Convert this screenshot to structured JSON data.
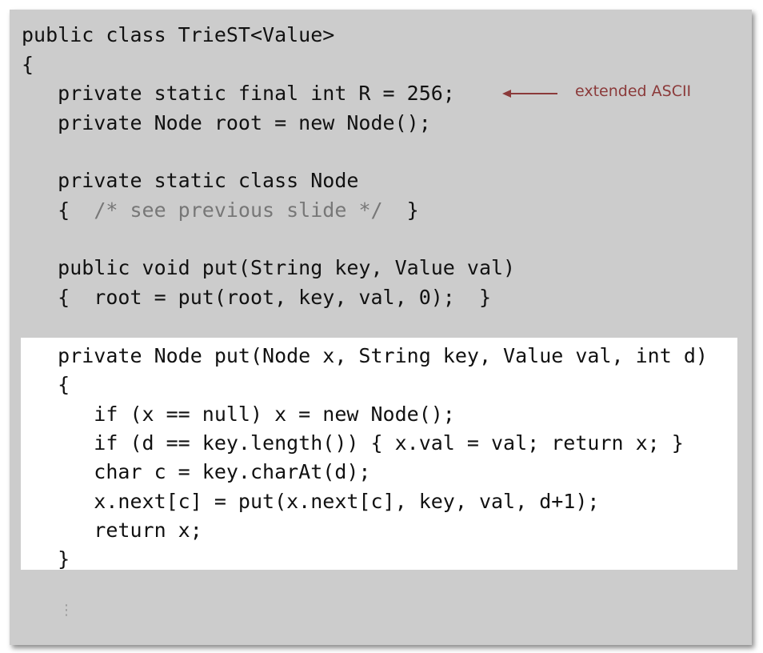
{
  "code": {
    "l1": "public class TrieST<Value>",
    "l2": "{",
    "l3": "   private static final int R = 256;",
    "l4": "   private Node root = new Node();",
    "l5": "   private static class Node",
    "l6_brace_open": "   {  ",
    "l6_comment": "/* see previous slide */",
    "l6_brace_close": "  }",
    "l7": "   public void put(String key, Value val)",
    "l8": "   {  root = put(root, key, val, 0);  }",
    "l9": "   private Node put(Node x, String key, Value val, int d)",
    "l10": "   {",
    "l11": "      if (x == null) x = new Node();",
    "l12": "      if (d == key.length()) { x.val = val; return x; }",
    "l13": "      char c = key.charAt(d);",
    "l14": "      x.next[c] = put(x.next[c], key, val, d+1);",
    "l15": "      return x;",
    "l16": "   }",
    "ellipsis": "⋮"
  },
  "annotation": {
    "text": "extended ASCII",
    "color": "#8b3a3a"
  },
  "colors": {
    "panel": "#cccccc",
    "highlight": "#ffffff",
    "code": "#111111",
    "comment": "#777777"
  }
}
